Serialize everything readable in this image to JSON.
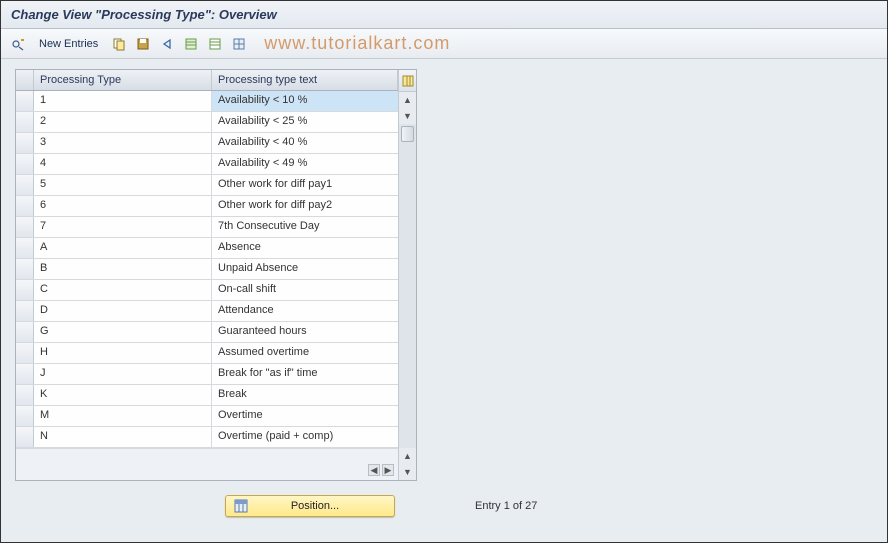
{
  "title": "Change View \"Processing Type\": Overview",
  "toolbar": {
    "new_entries_label": "New Entries"
  },
  "watermark": "www.tutorialkart.com",
  "table": {
    "columns": {
      "code": "Processing Type",
      "text": "Processing type text"
    },
    "rows": [
      {
        "code": "1",
        "text": "Availability < 10 %"
      },
      {
        "code": "2",
        "text": "Availability < 25 %"
      },
      {
        "code": "3",
        "text": "Availability < 40 %"
      },
      {
        "code": "4",
        "text": "Availability < 49 %"
      },
      {
        "code": "5",
        "text": "Other work for diff pay1"
      },
      {
        "code": "6",
        "text": "Other work for diff pay2"
      },
      {
        "code": "7",
        "text": "7th Consecutive Day"
      },
      {
        "code": "A",
        "text": "Absence"
      },
      {
        "code": "B",
        "text": "Unpaid Absence"
      },
      {
        "code": "C",
        "text": "On-call shift"
      },
      {
        "code": "D",
        "text": "Attendance"
      },
      {
        "code": "G",
        "text": "Guaranteed hours"
      },
      {
        "code": "H",
        "text": "Assumed overtime"
      },
      {
        "code": "J",
        "text": "Break for \"as if\" time"
      },
      {
        "code": "K",
        "text": "Break"
      },
      {
        "code": "M",
        "text": "Overtime"
      },
      {
        "code": "N",
        "text": "Overtime (paid + comp)"
      }
    ]
  },
  "footer": {
    "position_label": "Position...",
    "entry_text": "Entry 1 of 27"
  }
}
